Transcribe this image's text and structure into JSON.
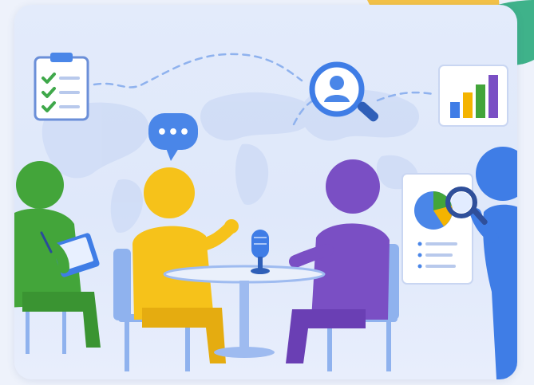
{
  "scene": {
    "speech_bubble_text": "•••"
  },
  "colors": {
    "background": "#eef2fb",
    "card": "#e1e9fb",
    "map": "#cfdcf6",
    "yellow_person": "#f6c21a",
    "purple_person": "#7a4fc4",
    "green_person": "#43a53a",
    "blue_person": "#3f7de6",
    "speech_bubble": "#4a86e8",
    "table": "#eaf0fb",
    "chair": "#8fb2ee",
    "accent_yellow_blob": "#f4c247",
    "accent_green_blob": "#3fb28a"
  },
  "icons": [
    "clipboard-checklist-icon",
    "magnifier-user-icon",
    "bar-chart-icon",
    "pie-chart-board-icon",
    "speech-bubble-icon",
    "microphone-icon",
    "world-map"
  ]
}
